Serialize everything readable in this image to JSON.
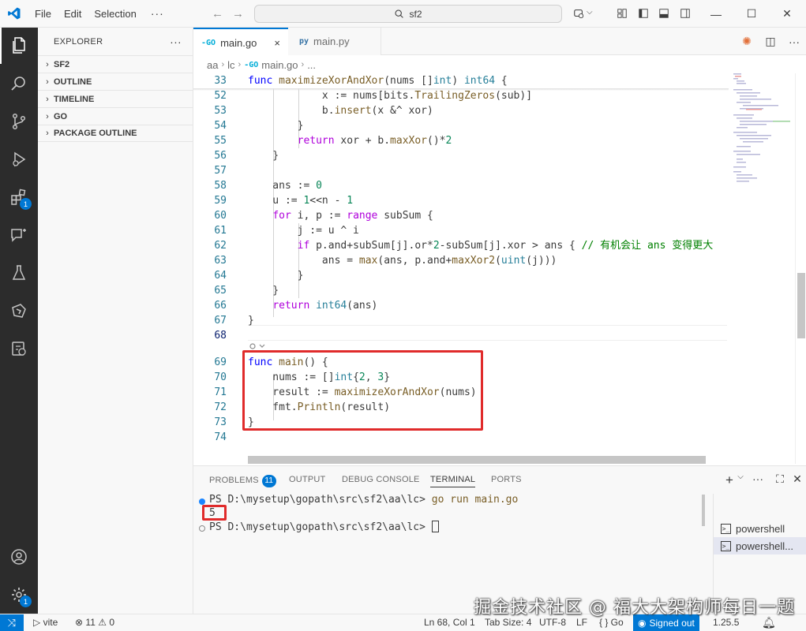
{
  "window": {
    "menu": [
      "File",
      "Edit",
      "Selection"
    ],
    "more": "···",
    "search": "sf2"
  },
  "activity_bar": {
    "items": [
      "files-icon",
      "search-icon",
      "source-control-icon",
      "run-debug-icon",
      "extensions-icon",
      "chat-icon",
      "testing-icon",
      "go-icon",
      "remote-icon"
    ],
    "extensions_badge": "1",
    "settings_badge": "1"
  },
  "sidebar": {
    "title": "EXPLORER",
    "more": "···",
    "sections": [
      "SF2",
      "OUTLINE",
      "TIMELINE",
      "GO",
      "PACKAGE OUTLINE"
    ]
  },
  "tabs": [
    {
      "icon": "-GO",
      "label": "main.go",
      "active": true,
      "close": "×"
    },
    {
      "icon": "py",
      "label": "main.py",
      "active": false
    }
  ],
  "breadcrumb": {
    "parts": [
      "aa",
      "lc",
      "main.go",
      "..."
    ],
    "go_icon": "-GO"
  },
  "editor": {
    "sticky_line": {
      "num": "33",
      "tokens": [
        [
          "kw",
          "func "
        ],
        [
          "fn",
          "maximizeXorAndXor"
        ],
        [
          "",
          "(nums []"
        ],
        [
          "ty",
          "int"
        ],
        [
          "",
          ") "
        ],
        [
          "ty",
          "int64"
        ],
        [
          "",
          " {"
        ]
      ]
    },
    "current_line": "68",
    "lines": [
      {
        "num": "52",
        "tokens": [
          [
            "",
            "            x := nums[bits."
          ],
          [
            "fn",
            "TrailingZeros"
          ],
          [
            "",
            "(sub)]"
          ]
        ]
      },
      {
        "num": "53",
        "tokens": [
          [
            "",
            "            b."
          ],
          [
            "fn",
            "insert"
          ],
          [
            "",
            "(x &^ xor)"
          ]
        ]
      },
      {
        "num": "54",
        "tokens": [
          [
            "",
            "        }"
          ]
        ]
      },
      {
        "num": "55",
        "tokens": [
          [
            "",
            "        "
          ],
          [
            "kw2",
            "return"
          ],
          [
            "",
            " xor + b."
          ],
          [
            "fn",
            "maxXor"
          ],
          [
            "",
            "()*"
          ],
          [
            "nm",
            "2"
          ]
        ]
      },
      {
        "num": "56",
        "tokens": [
          [
            "",
            "    }"
          ]
        ]
      },
      {
        "num": "57",
        "tokens": []
      },
      {
        "num": "58",
        "tokens": [
          [
            "",
            "    ans := "
          ],
          [
            "nm",
            "0"
          ]
        ]
      },
      {
        "num": "59",
        "tokens": [
          [
            "",
            "    u := "
          ],
          [
            "nm",
            "1"
          ],
          [
            "",
            "<<n - "
          ],
          [
            "nm",
            "1"
          ]
        ]
      },
      {
        "num": "60",
        "tokens": [
          [
            "",
            "    "
          ],
          [
            "kw2",
            "for"
          ],
          [
            "",
            " i, p := "
          ],
          [
            "kw2",
            "range"
          ],
          [
            "",
            " subSum {"
          ]
        ]
      },
      {
        "num": "61",
        "tokens": [
          [
            "",
            "        j := u ^ i"
          ]
        ]
      },
      {
        "num": "62",
        "tokens": [
          [
            "",
            "        "
          ],
          [
            "kw2",
            "if"
          ],
          [
            "",
            " p.and+subSum[j].or*"
          ],
          [
            "nm",
            "2"
          ],
          [
            "",
            "-subSum[j].xor > ans { "
          ],
          [
            "cm",
            "// 有机会让 ans 变得更大"
          ]
        ]
      },
      {
        "num": "63",
        "tokens": [
          [
            "",
            "            ans = "
          ],
          [
            "fn",
            "max"
          ],
          [
            "",
            "(ans, p.and+"
          ],
          [
            "fn",
            "maxXor2"
          ],
          [
            "",
            "("
          ],
          [
            "ty",
            "uint"
          ],
          [
            "",
            "(j)))"
          ]
        ]
      },
      {
        "num": "64",
        "tokens": [
          [
            "",
            "        }"
          ]
        ]
      },
      {
        "num": "65",
        "tokens": [
          [
            "",
            "    }"
          ]
        ]
      },
      {
        "num": "66",
        "tokens": [
          [
            "",
            "    "
          ],
          [
            "kw2",
            "return"
          ],
          [
            "",
            " "
          ],
          [
            "ty",
            "int64"
          ],
          [
            "",
            "(ans)"
          ]
        ]
      },
      {
        "num": "67",
        "tokens": [
          [
            "",
            "}"
          ]
        ]
      },
      {
        "num": "68",
        "tokens": []
      },
      {
        "num": "69",
        "tokens": [
          [
            "kw",
            "func"
          ],
          [
            "",
            " "
          ],
          [
            "fn",
            "main"
          ],
          [
            "",
            "() {"
          ]
        ]
      },
      {
        "num": "70",
        "tokens": [
          [
            "",
            "    nums := []"
          ],
          [
            "ty",
            "int"
          ],
          [
            "",
            "{"
          ],
          [
            "nm",
            "2"
          ],
          [
            "",
            ", "
          ],
          [
            "nm",
            "3"
          ],
          [
            "",
            "}"
          ]
        ]
      },
      {
        "num": "71",
        "tokens": [
          [
            "",
            "    result := "
          ],
          [
            "fn",
            "maximizeXorAndXor"
          ],
          [
            "",
            "(nums)"
          ]
        ]
      },
      {
        "num": "72",
        "tokens": [
          [
            "",
            "    fmt."
          ],
          [
            "fn",
            "Println"
          ],
          [
            "",
            "(result)"
          ]
        ]
      },
      {
        "num": "73",
        "tokens": [
          [
            "",
            "}"
          ]
        ]
      },
      {
        "num": "74",
        "tokens": []
      }
    ]
  },
  "panel": {
    "tabs": [
      "PROBLEMS",
      "OUTPUT",
      "DEBUG CONSOLE",
      "TERMINAL",
      "PORTS"
    ],
    "active_tab": "TERMINAL",
    "problems_count": "11",
    "terminal": {
      "prompt1": "PS D:\\mysetup\\gopath\\src\\sf2\\aa\\lc> ",
      "command": "go run main.go",
      "output": "5",
      "prompt2": "PS D:\\mysetup\\gopath\\src\\sf2\\aa\\lc> "
    },
    "terminals": [
      "powershell",
      "powershell..."
    ]
  },
  "status_bar": {
    "branch": "vite",
    "errors": "11",
    "warnings": "0",
    "position": "Ln 68, Col 1",
    "tab_size": "Tab Size: 4",
    "encoding": "UTF-8",
    "eol": "LF",
    "language": "{ } Go",
    "account": "Signed out",
    "go_version": "1.25.5"
  },
  "watermark": "掘金技术社区 @ 福大大架构师每日一题",
  "colors": {
    "accent": "#0078d4",
    "highlight": "#e02b2b"
  }
}
